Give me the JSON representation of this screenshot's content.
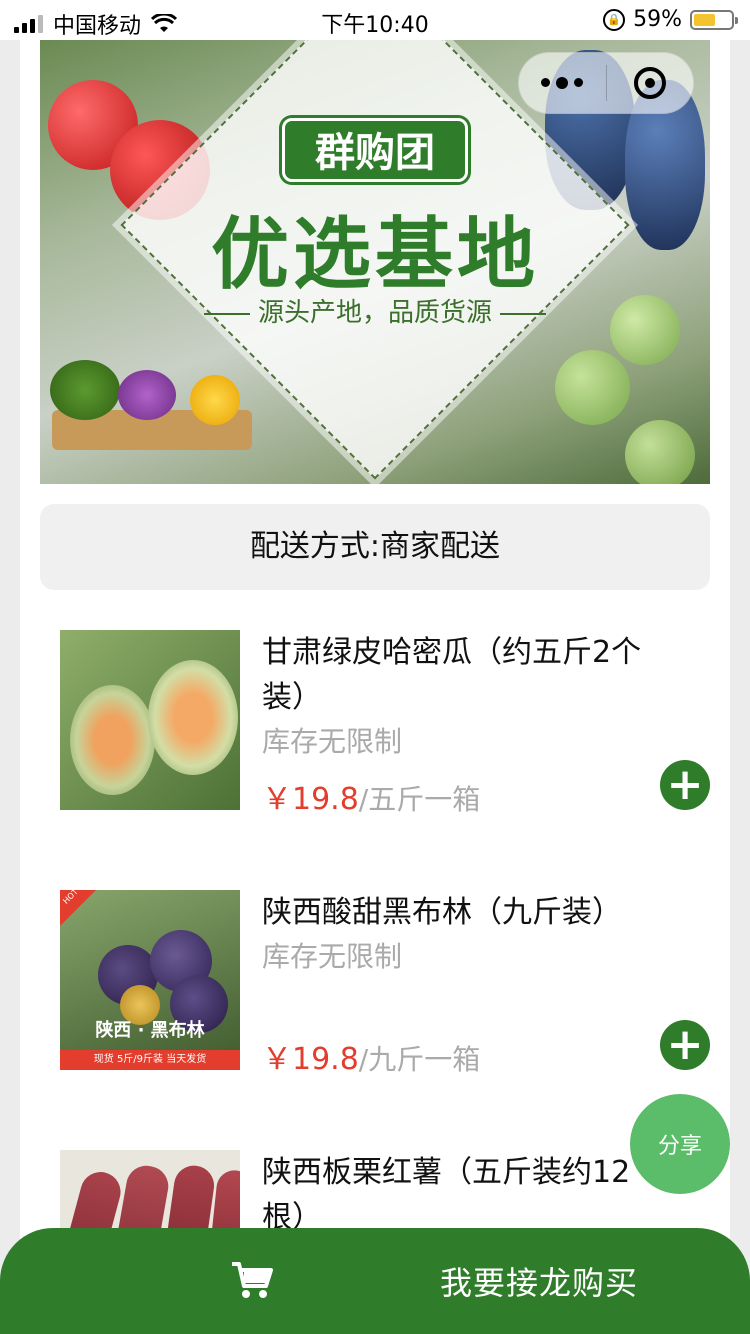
{
  "status_bar": {
    "carrier": "中国移动",
    "time": "下午10:40",
    "battery": "59%",
    "battery_level": 0.59
  },
  "banner": {
    "tag": "群购团",
    "headline": "优选基地",
    "subline": "源头产地，品质货源",
    "capsule": {
      "more_icon": "more-dots-icon",
      "close_icon": "target-close-icon"
    }
  },
  "delivery": {
    "text": "配送方式:商家配送"
  },
  "products": [
    {
      "name": "甘肃绿皮哈密瓜（约五斤2个装）",
      "stock": "库存无限制",
      "currency": "￥",
      "price": "19.8",
      "unit": "/五斤一箱"
    },
    {
      "name": "陕西酸甜黑布林（九斤装）",
      "stock": "库存无限制",
      "currency": "￥",
      "price": "19.8",
      "unit": "/九斤一箱",
      "image_text": {
        "badge": "HOT",
        "title": "陕西 · 黑布林",
        "strip": "现货 5斤/9斤装 当天发货"
      }
    },
    {
      "name": "陕西板栗红薯（五斤装约12根）"
    }
  ],
  "share": {
    "label": "分享"
  },
  "buy_bar": {
    "label": "我要接龙购买",
    "icon": "cart-icon"
  },
  "colors": {
    "brand_green": "#2f7d2a",
    "share_green": "#5bbd6a",
    "price_red": "#e23d2d",
    "muted_text": "#aaaaaa"
  }
}
